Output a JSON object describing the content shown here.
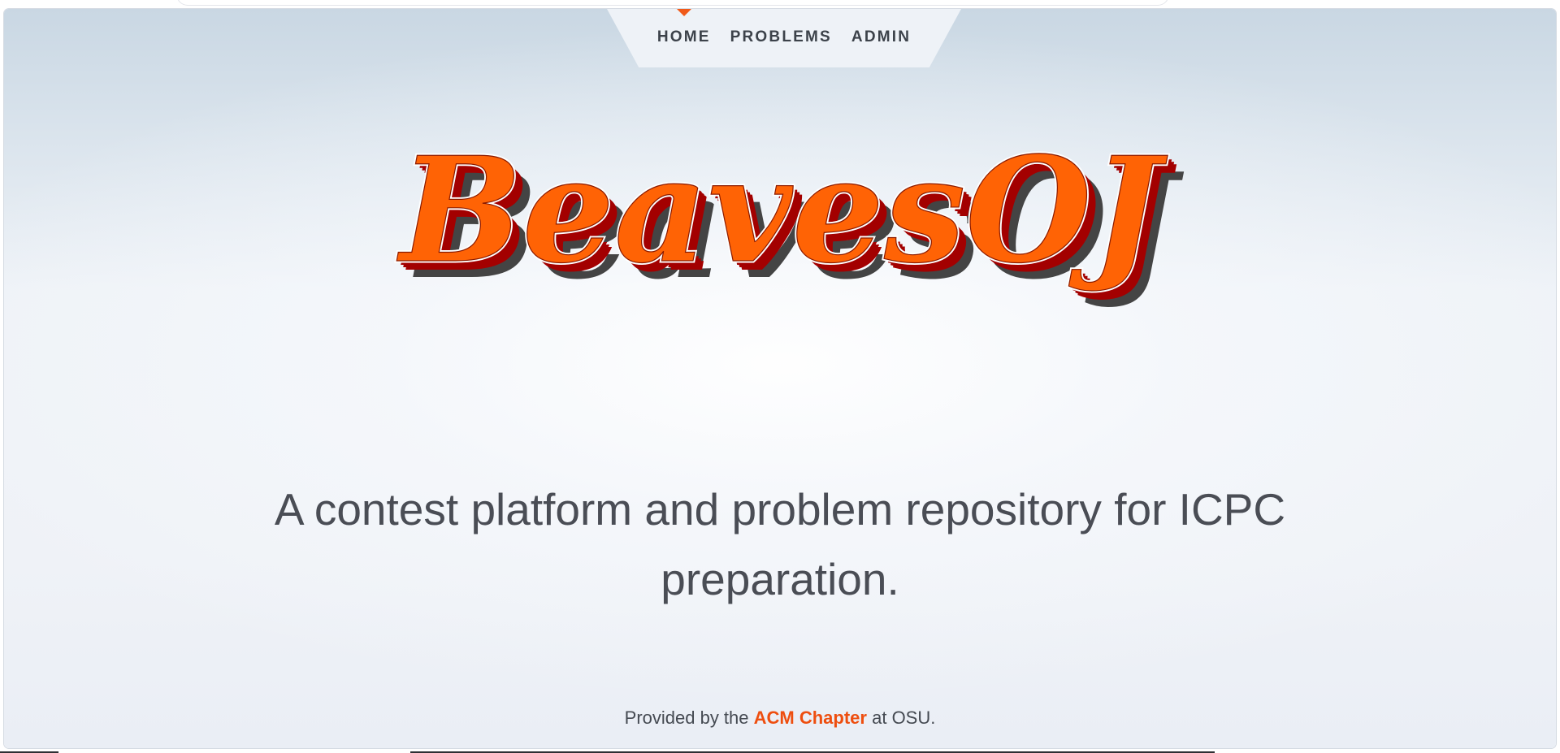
{
  "nav": {
    "items": [
      {
        "label": "HOME",
        "active": true
      },
      {
        "label": "PROBLEMS",
        "active": false
      },
      {
        "label": "ADMIN",
        "active": false
      }
    ]
  },
  "hero": {
    "logo_text": "BeavesOJ",
    "tagline": "A contest platform and problem repository for ICPC preparation."
  },
  "footer": {
    "prefix": "Provided by the",
    "link_label": "ACM Chapter",
    "suffix": "at OSU."
  },
  "colors": {
    "accent": "#ee4e0f",
    "logo_fill": "#ff6305",
    "logo_extrude": "#a30000",
    "logo_shadow": "#444444",
    "text": "#4a4d55"
  }
}
